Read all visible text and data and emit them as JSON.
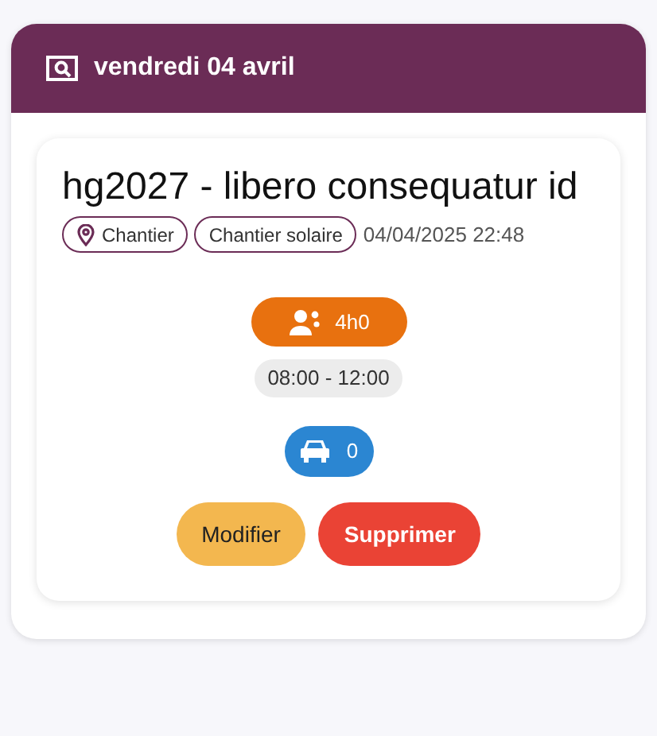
{
  "header": {
    "title": "vendredi 04 avril"
  },
  "event": {
    "title": "hg2027 - libero consequatur id",
    "tags": [
      {
        "label": "Chantier",
        "kind": "location"
      },
      {
        "label": "Chantier solaire",
        "kind": "plain"
      }
    ],
    "timestamp": "04/04/2025 22:48",
    "duration": "4h0",
    "hours": "08:00 - 12:00",
    "vehicles": "0",
    "buttons": [
      {
        "label": "Modifier",
        "kind": "edit"
      },
      {
        "label": "Supprimer",
        "kind": "delete"
      }
    ]
  }
}
